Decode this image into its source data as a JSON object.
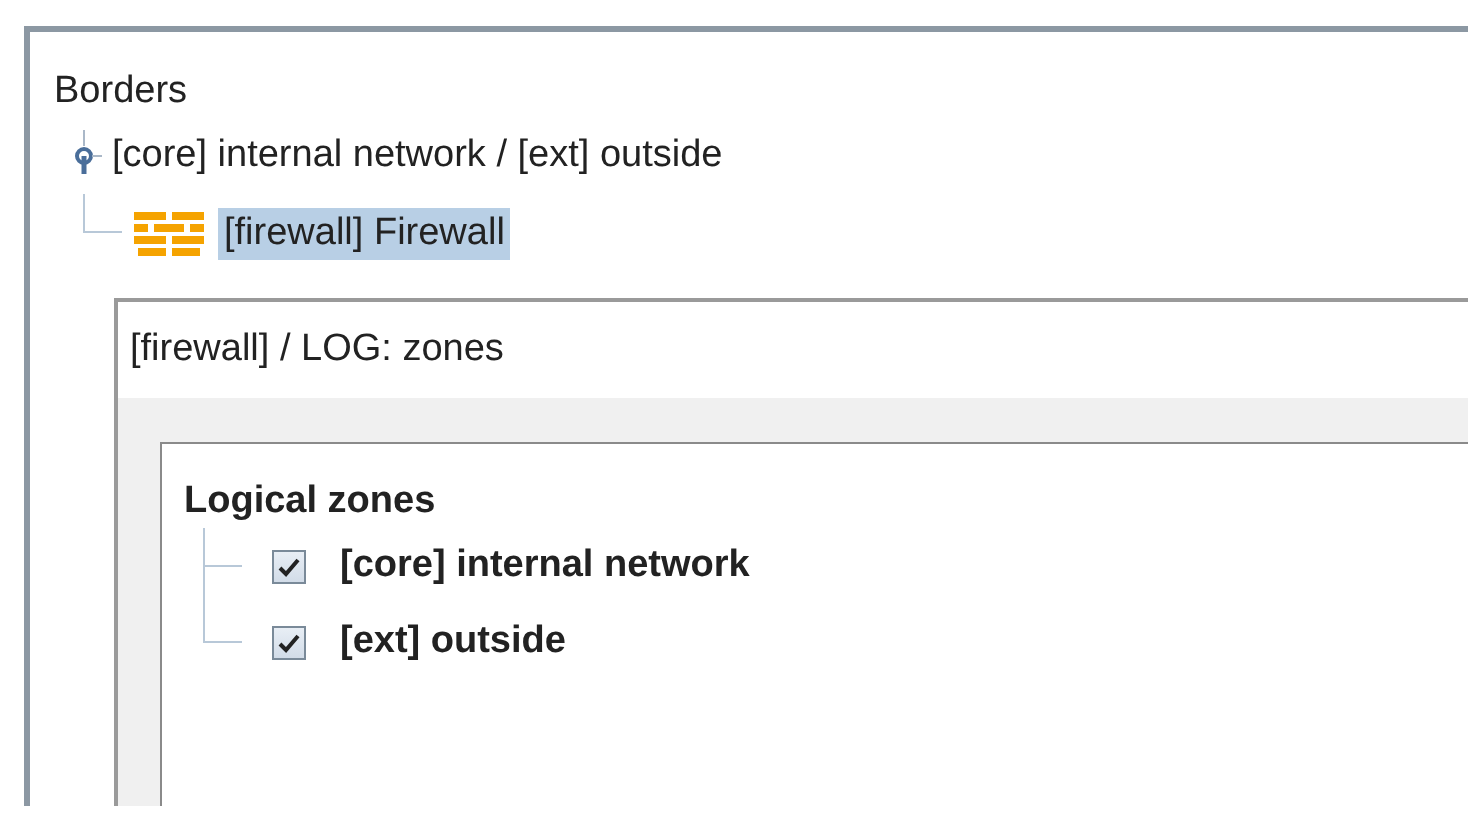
{
  "tree": {
    "title": "Borders",
    "nodes": [
      {
        "label": "[core] internal network / [ext] outside",
        "expanded": true,
        "selected": false,
        "children": [
          {
            "label": "[firewall] Firewall",
            "selected": true
          }
        ]
      }
    ]
  },
  "dialog": {
    "title": "[firewall] / LOG: zones",
    "zones": {
      "title": "Logical zones",
      "items": [
        {
          "label": "[core] internal network",
          "checked": true
        },
        {
          "label": "[ext] outside",
          "checked": true
        }
      ]
    }
  }
}
